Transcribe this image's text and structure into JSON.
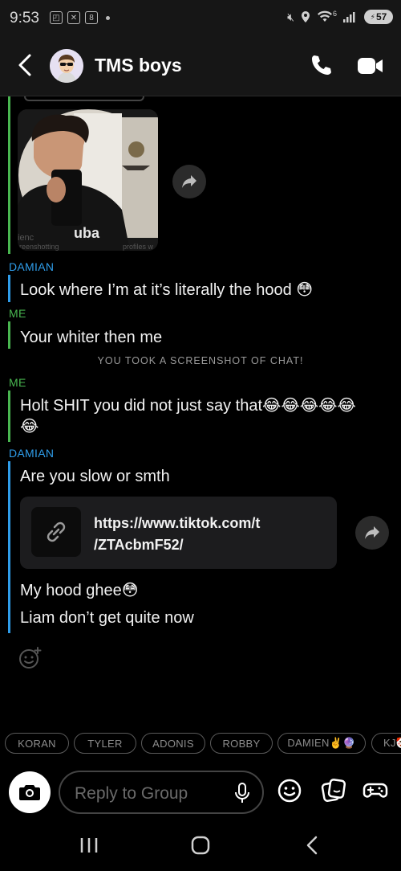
{
  "status_bar": {
    "time": "9:53",
    "battery": "57",
    "network": "6"
  },
  "header": {
    "title": "TMS boys"
  },
  "messages": {
    "sender_damian_1": "DAMIAN",
    "snap_faint_text": "ienc",
    "snap_faint_text_2": "reenshotting",
    "snap_faint_text_3": "profiles w",
    "msg_1": "Look where I’m at it’s literally the hood 😳",
    "sender_me_1": "ME",
    "msg_2": "Your whiter then me",
    "screenshot_notice": "YOU TOOK A SCREENSHOT OF CHAT!",
    "sender_me_2": "ME",
    "msg_3_line1": "Holt SHIT you did not just say that😂😂😂😂😂",
    "msg_3_line2": "😂",
    "sender_damian_2": "DAMIAN",
    "msg_4": "Are you slow or smth",
    "link_line1": "https://www.tiktok.com/t",
    "link_line2": "/ZTAcbmF52/",
    "msg_5": "My hood ghee😳",
    "msg_6": "Liam don’t get quite now"
  },
  "chips": [
    "KORAN",
    "TYLER",
    "ADONIS",
    "ROBBY",
    "DAMIEN✌️🔮",
    "KJ🤡"
  ],
  "input": {
    "placeholder": "Reply to Group"
  },
  "icons": {
    "back": "chevron-left-icon",
    "call": "phone-icon",
    "video": "video-call-icon",
    "share": "share-arrow-icon",
    "link": "link-icon",
    "react": "add-reaction-icon",
    "camera": "camera-icon",
    "mic": "microphone-icon",
    "emoji": "emoji-icon",
    "sticker": "sticker-icon",
    "games": "game-controller-icon"
  },
  "colors": {
    "me": "#49b650",
    "friend": "#2f9dea",
    "background": "#000000",
    "header": "#161616"
  }
}
